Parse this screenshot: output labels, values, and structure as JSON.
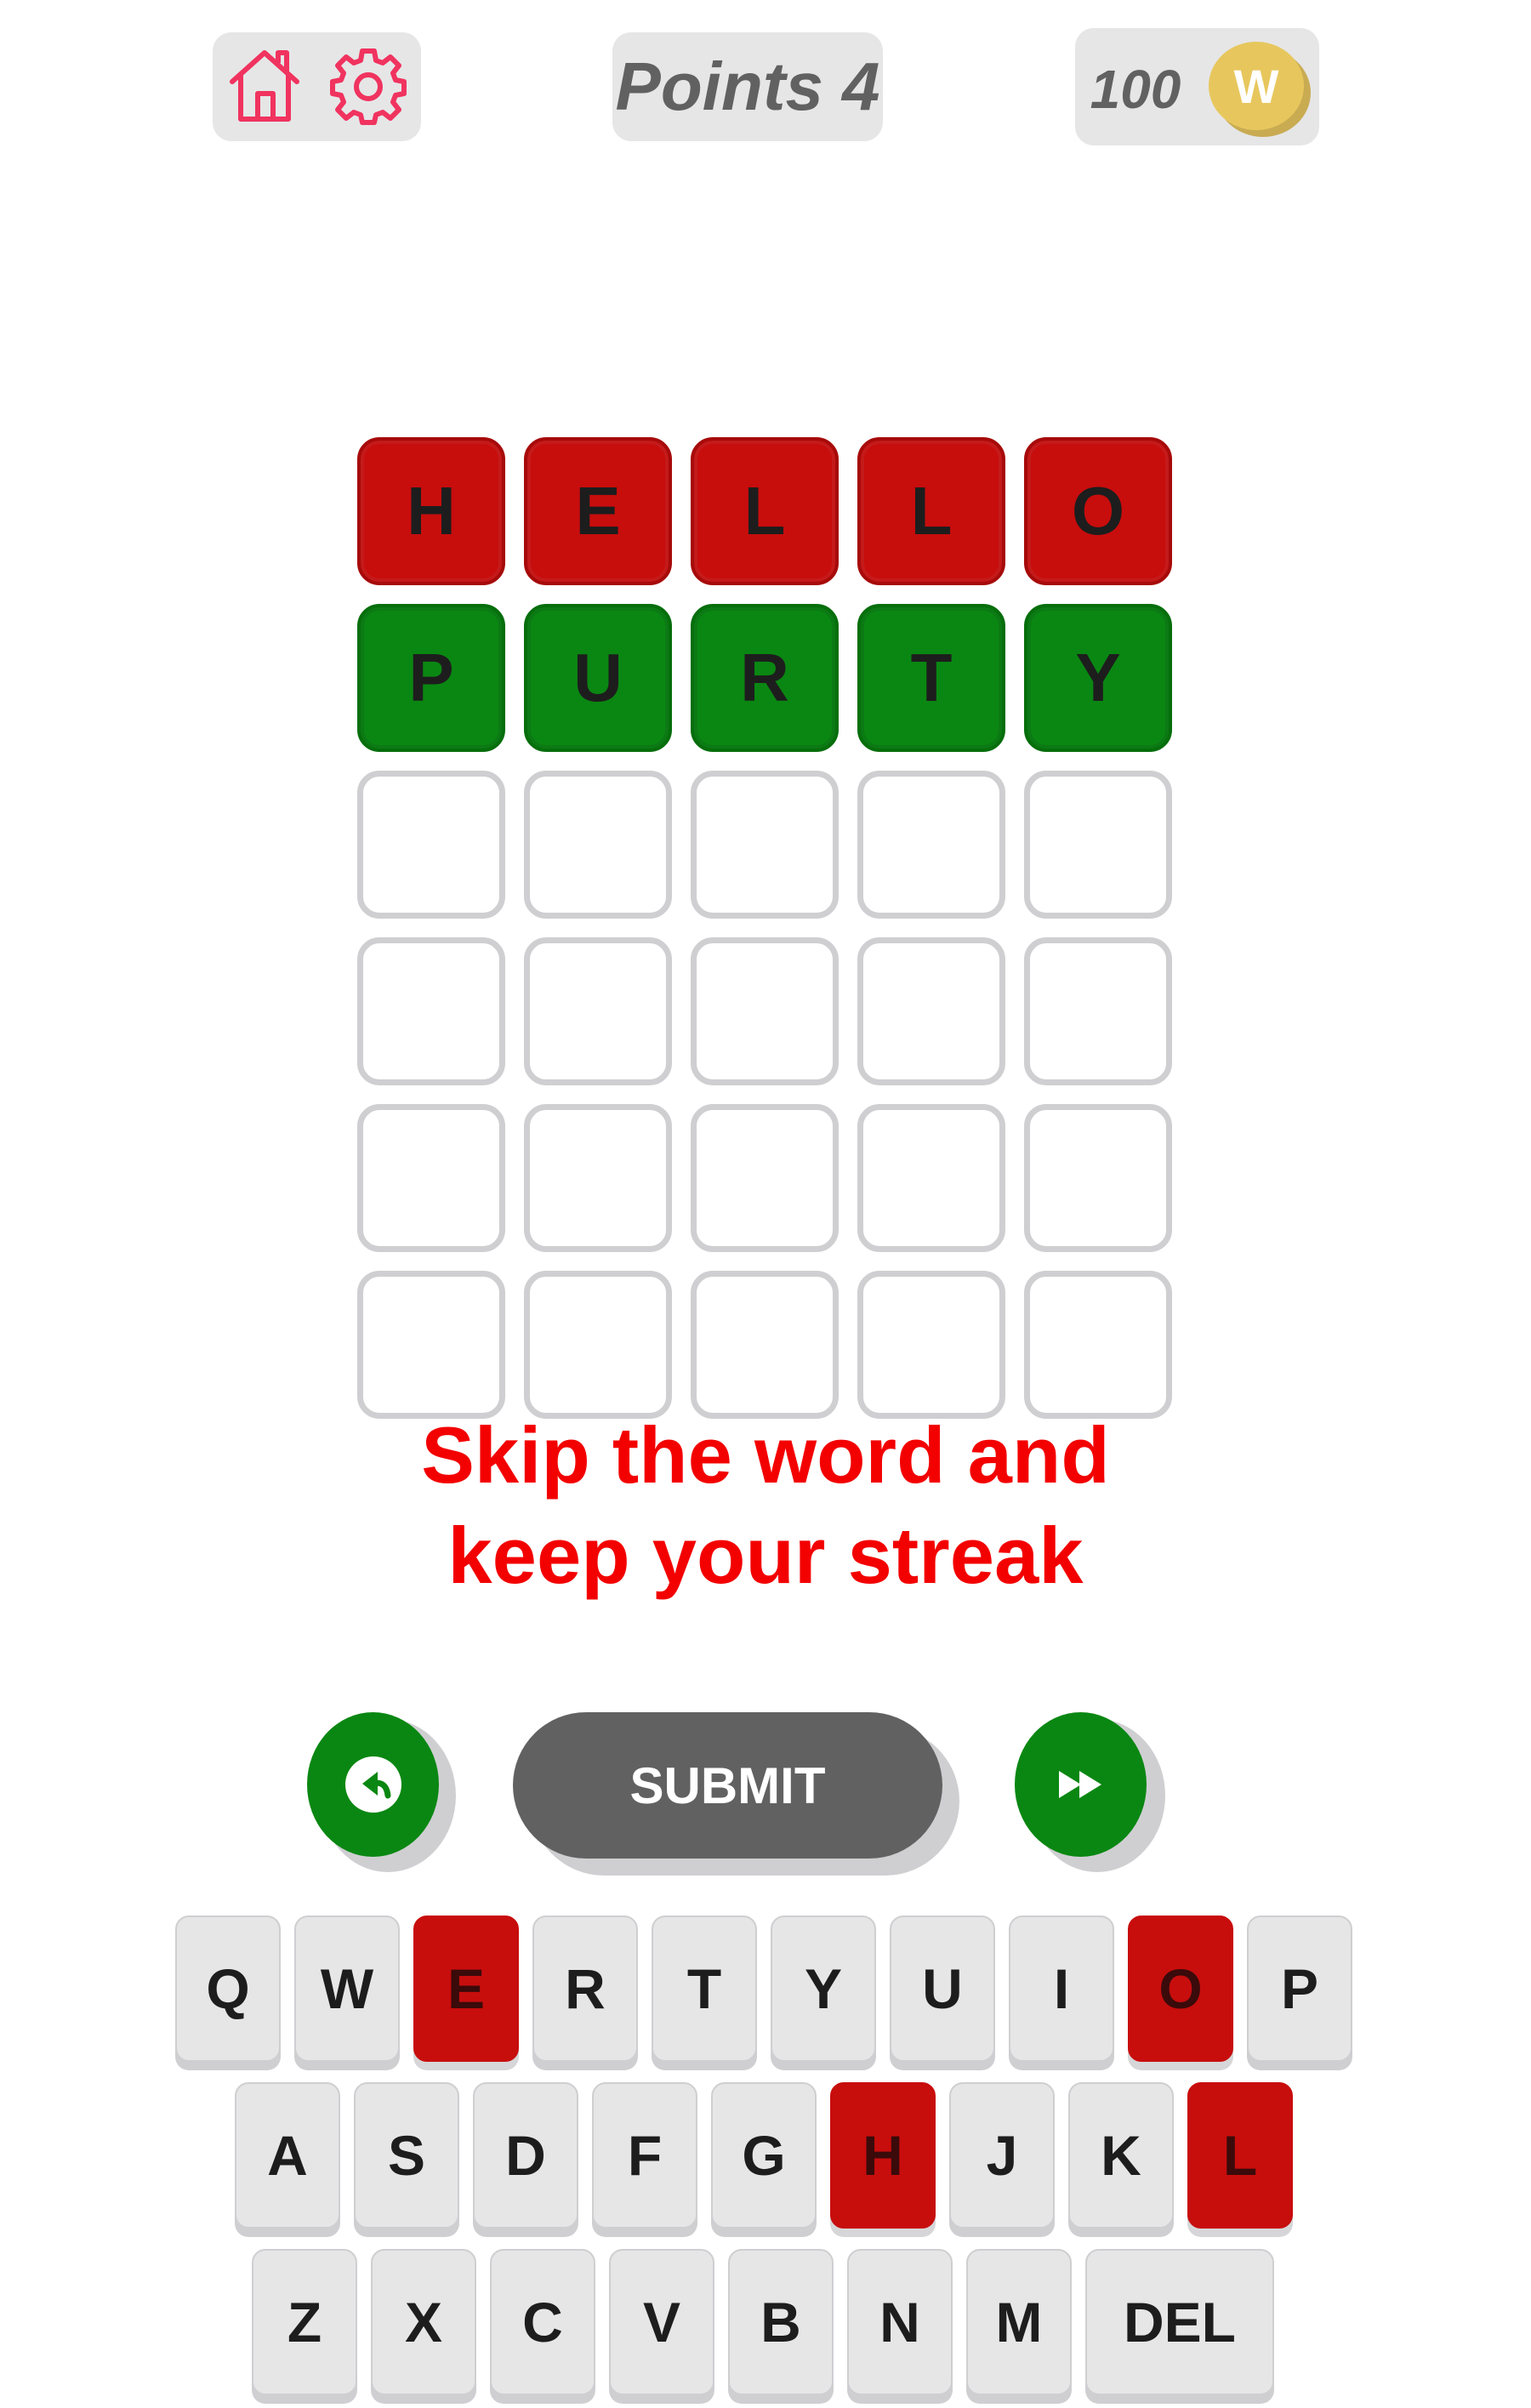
{
  "header": {
    "points_label": "Points",
    "points_value": "4",
    "coins": "100",
    "coin_letter": "W",
    "icons": {
      "home": "home-icon",
      "settings": "gear-icon",
      "coin": "coin-icon"
    }
  },
  "board": {
    "rows": [
      {
        "letters": [
          "H",
          "E",
          "L",
          "L",
          "O"
        ],
        "state": "absent"
      },
      {
        "letters": [
          "P",
          "U",
          "R",
          "T",
          "Y"
        ],
        "state": "correct"
      },
      {
        "letters": [
          "",
          "",
          "",
          "",
          ""
        ],
        "state": "empty"
      },
      {
        "letters": [
          "",
          "",
          "",
          "",
          ""
        ],
        "state": "empty"
      },
      {
        "letters": [
          "",
          "",
          "",
          "",
          ""
        ],
        "state": "empty"
      },
      {
        "letters": [
          "",
          "",
          "",
          "",
          ""
        ],
        "state": "empty"
      }
    ]
  },
  "message": {
    "line1": "Skip the word and",
    "line2": "keep your streak"
  },
  "actions": {
    "undo_icon": "undo-arrow-icon",
    "submit_label": "SUBMIT",
    "skip_icon": "fast-forward-icon"
  },
  "keyboard": {
    "rows": [
      [
        {
          "key": "Q"
        },
        {
          "key": "W"
        },
        {
          "key": "E",
          "state": "absent"
        },
        {
          "key": "R"
        },
        {
          "key": "T"
        },
        {
          "key": "Y"
        },
        {
          "key": "U"
        },
        {
          "key": "I"
        },
        {
          "key": "O",
          "state": "absent"
        },
        {
          "key": "P"
        }
      ],
      [
        {
          "key": "A"
        },
        {
          "key": "S"
        },
        {
          "key": "D"
        },
        {
          "key": "F"
        },
        {
          "key": "G"
        },
        {
          "key": "H",
          "state": "absent"
        },
        {
          "key": "J"
        },
        {
          "key": "K"
        },
        {
          "key": "L",
          "state": "absent"
        }
      ],
      [
        {
          "key": "Z"
        },
        {
          "key": "X"
        },
        {
          "key": "C"
        },
        {
          "key": "V"
        },
        {
          "key": "B"
        },
        {
          "key": "N"
        },
        {
          "key": "M"
        },
        {
          "key": "DEL",
          "wide": true
        }
      ]
    ]
  },
  "colors": {
    "absent": "#c80d0d",
    "correct": "#0a8712",
    "message": "#f30000",
    "icon_accent": "#f0335f",
    "coin": "#e7c75d"
  }
}
